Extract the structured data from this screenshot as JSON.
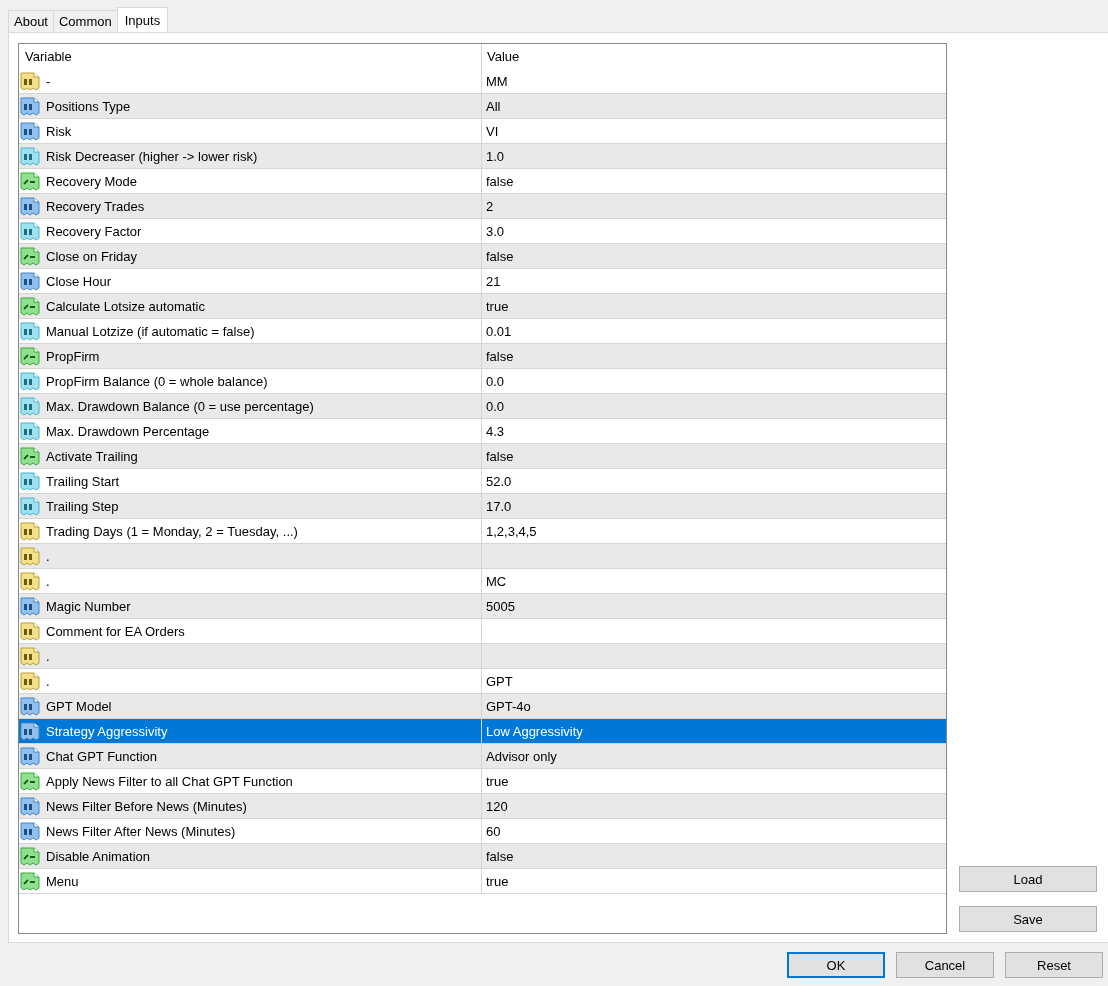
{
  "tabs": [
    {
      "label": "About",
      "selected": false
    },
    {
      "label": "Common",
      "selected": false
    },
    {
      "label": "Inputs",
      "selected": true
    }
  ],
  "table": {
    "columns": [
      "Variable",
      "Value"
    ],
    "rows": [
      {
        "kind": "string",
        "variable": "-",
        "value": "MM",
        "selected": false
      },
      {
        "kind": "integer",
        "variable": "Positions Type",
        "value": "All",
        "selected": false
      },
      {
        "kind": "integer",
        "variable": "Risk",
        "value": "VI",
        "selected": false
      },
      {
        "kind": "double",
        "variable": "Risk Decreaser (higher -> lower risk)",
        "value": "1.0",
        "selected": false
      },
      {
        "kind": "bool",
        "variable": "Recovery Mode",
        "value": "false",
        "selected": false
      },
      {
        "kind": "integer",
        "variable": "Recovery Trades",
        "value": "2",
        "selected": false
      },
      {
        "kind": "double",
        "variable": "Recovery Factor",
        "value": "3.0",
        "selected": false
      },
      {
        "kind": "bool",
        "variable": "Close on Friday",
        "value": "false",
        "selected": false
      },
      {
        "kind": "integer",
        "variable": "Close Hour",
        "value": "21",
        "selected": false
      },
      {
        "kind": "bool",
        "variable": "Calculate Lotsize automatic",
        "value": "true",
        "selected": false
      },
      {
        "kind": "double",
        "variable": "Manual Lotzize (if automatic = false)",
        "value": "0.01",
        "selected": false
      },
      {
        "kind": "bool",
        "variable": "PropFirm",
        "value": "false",
        "selected": false
      },
      {
        "kind": "double",
        "variable": "PropFirm Balance (0 = whole balance)",
        "value": "0.0",
        "selected": false
      },
      {
        "kind": "double",
        "variable": "Max. Drawdown Balance (0 = use percentage)",
        "value": "0.0",
        "selected": false
      },
      {
        "kind": "double",
        "variable": "Max. Drawdown Percentage",
        "value": "4.3",
        "selected": false
      },
      {
        "kind": "bool",
        "variable": "Activate Trailing",
        "value": "false",
        "selected": false
      },
      {
        "kind": "double",
        "variable": "Trailing Start",
        "value": "52.0",
        "selected": false
      },
      {
        "kind": "double",
        "variable": "Trailing Step",
        "value": "17.0",
        "selected": false
      },
      {
        "kind": "string",
        "variable": "Trading Days (1 = Monday, 2 = Tuesday, ...)",
        "value": "1,2,3,4,5",
        "selected": false
      },
      {
        "kind": "string",
        "variable": ".",
        "selected": false
      },
      {
        "kind": "string",
        "variable": ".",
        "value": "MC",
        "selected": false
      },
      {
        "kind": "integer",
        "variable": "Magic Number",
        "value": "5005",
        "selected": false
      },
      {
        "kind": "string",
        "variable": "Comment for EA Orders",
        "selected": false
      },
      {
        "kind": "string",
        "variable": ".",
        "selected": false
      },
      {
        "kind": "string",
        "variable": ".",
        "value": "GPT",
        "selected": false
      },
      {
        "kind": "integer",
        "variable": "GPT Model",
        "value": "GPT-4o",
        "selected": false
      },
      {
        "kind": "integer",
        "variable": "Strategy Aggressivity",
        "value": "Low Aggressivity",
        "selected": true
      },
      {
        "kind": "integer",
        "variable": "Chat GPT Function",
        "value": "Advisor only",
        "selected": false
      },
      {
        "kind": "bool",
        "variable": "Apply News Filter to all Chat GPT Function",
        "value": "true",
        "selected": false
      },
      {
        "kind": "integer",
        "variable": "News Filter Before News (Minutes)",
        "value": "120",
        "selected": false
      },
      {
        "kind": "integer",
        "variable": "News Filter After News (Minutes)",
        "value": "60",
        "selected": false
      },
      {
        "kind": "bool",
        "variable": "Disable Animation",
        "value": "false",
        "selected": false
      },
      {
        "kind": "bool",
        "variable": "Menu",
        "value": "true",
        "selected": false
      }
    ]
  },
  "side_buttons": [
    "Load",
    "Save"
  ],
  "dialog_buttons": [
    {
      "label": "OK",
      "default": true
    },
    {
      "label": "Cancel",
      "default": false
    },
    {
      "label": "Reset",
      "default": false
    }
  ]
}
